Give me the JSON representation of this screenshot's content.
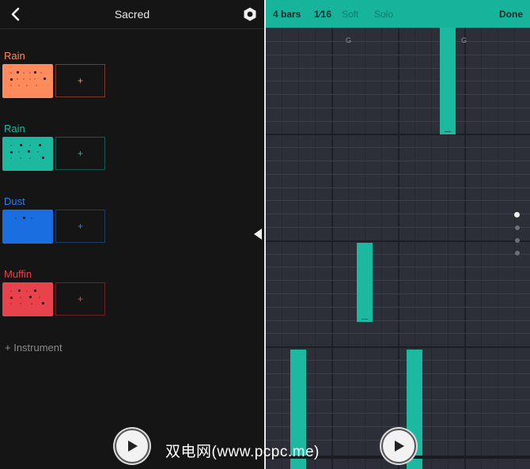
{
  "left_panel": {
    "title": "Sacred",
    "instruments": [
      {
        "name": "Rain",
        "color": "#ff8a5c",
        "add_label": "+"
      },
      {
        "name": "Rain",
        "color": "#1cb8a0",
        "add_label": "+"
      },
      {
        "name": "Dust",
        "color": "#1a6ee0",
        "add_label": "+"
      },
      {
        "name": "Muffin",
        "color": "#e8424c",
        "add_label": "+"
      }
    ],
    "add_instrument": "+ Instrument"
  },
  "sequencer": {
    "length": "4 bars",
    "step": "1⁄16",
    "soft": "Soft",
    "solo": "Solo",
    "done": "Done",
    "note_labels": [
      "G",
      "G"
    ],
    "page_count": 4,
    "active_page": 1,
    "accent_color": "#1cb8a0"
  },
  "watermark": "双电网(www.pcpc.me)"
}
